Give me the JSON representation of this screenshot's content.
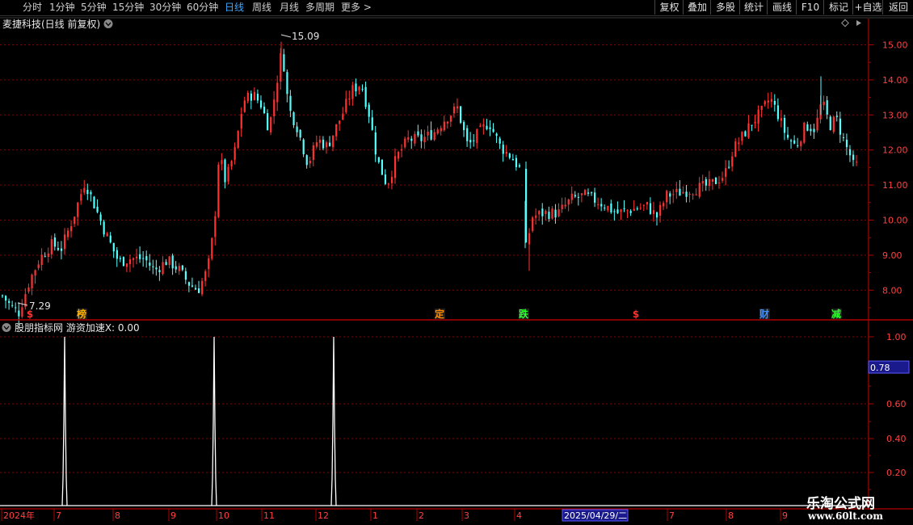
{
  "toolbar": {
    "periods": [
      {
        "label": "分时",
        "active": false
      },
      {
        "label": "1分钟",
        "active": false
      },
      {
        "label": "5分钟",
        "active": false
      },
      {
        "label": "15分钟",
        "active": false
      },
      {
        "label": "30分钟",
        "active": false
      },
      {
        "label": "60分钟",
        "active": false
      },
      {
        "label": "日线",
        "active": true
      },
      {
        "label": "周线",
        "active": false
      },
      {
        "label": "月线",
        "active": false
      },
      {
        "label": "多周期",
        "active": false
      },
      {
        "label": "更多 >",
        "active": false
      }
    ],
    "right_buttons": [
      "复权",
      "叠加",
      "多股",
      "统计",
      "画线",
      "F10",
      "标记",
      "+自选",
      "返回"
    ]
  },
  "main_panel": {
    "title": "麦捷科技(日线 前复权)",
    "title_icon": "chevron-down-icon",
    "settings_icon": "diamond-icon",
    "y_ticks": [
      "15.00",
      "14.00",
      "13.00",
      "12.00",
      "11.00",
      "10.00",
      "9.00",
      "8.00"
    ],
    "high_label": "15.09",
    "low_label": "7.29",
    "markers": [
      {
        "text": "$",
        "color": "#ff3030"
      },
      {
        "text": "榜",
        "color": "#ffb000"
      },
      {
        "text": "定",
        "color": "#ff8c00"
      },
      {
        "text": "跌",
        "color": "#30ff30"
      },
      {
        "text": "$",
        "color": "#ff3030"
      },
      {
        "text": "财",
        "color": "#4090ff"
      },
      {
        "text": "减",
        "color": "#30ff30"
      }
    ]
  },
  "indicator_panel": {
    "title": "股朋指标网  游资加速X: 0.00",
    "title_icon": "chevron-down-icon",
    "y_ticks": [
      "1.00",
      "0.60",
      "0.40",
      "0.20"
    ],
    "cursor_value": "0.78"
  },
  "date_axis": {
    "labels": [
      "2024年",
      "7",
      "8",
      "9",
      "10",
      "11",
      "12",
      "1",
      "2",
      "3",
      "4",
      "7",
      "8",
      "9"
    ],
    "cursor_date": "2025/04/29/二"
  },
  "watermark": {
    "line1": "乐淘公式网",
    "line2": "www.60lt.com"
  },
  "colors": {
    "up": "#ff3232",
    "down": "#54ffff",
    "grid": "#8b0000",
    "axis": "#b00000",
    "accent": "#3da8ff",
    "signal": "#ffffff"
  },
  "chart_data": {
    "type": "candlestick",
    "price_range": [
      7.2,
      15.35
    ],
    "close_path": [
      [
        0,
        7.9
      ],
      [
        12,
        7.55
      ],
      [
        22,
        7.35
      ],
      [
        36,
        8.3
      ],
      [
        48,
        8.9
      ],
      [
        62,
        9.3
      ],
      [
        75,
        9.2
      ],
      [
        90,
        10.1
      ],
      [
        104,
        11.1
      ],
      [
        118,
        10.3
      ],
      [
        130,
        9.6
      ],
      [
        146,
        8.8
      ],
      [
        160,
        8.9
      ],
      [
        178,
        8.9
      ],
      [
        190,
        8.55
      ],
      [
        206,
        8.85
      ],
      [
        220,
        8.6
      ],
      [
        232,
        8.2
      ],
      [
        244,
        8.0
      ],
      [
        256,
        8.6
      ],
      [
        264,
        9.8
      ],
      [
        270,
        11.9
      ],
      [
        278,
        11.1
      ],
      [
        290,
        12.0
      ],
      [
        300,
        13.4
      ],
      [
        312,
        13.6
      ],
      [
        322,
        13.3
      ],
      [
        332,
        12.6
      ],
      [
        342,
        14.0
      ],
      [
        348,
        14.9
      ],
      [
        356,
        13.2
      ],
      [
        366,
        12.7
      ],
      [
        380,
        11.6
      ],
      [
        392,
        12.3
      ],
      [
        404,
        12.1
      ],
      [
        414,
        12.6
      ],
      [
        424,
        13.1
      ],
      [
        434,
        13.7
      ],
      [
        446,
        13.9
      ],
      [
        456,
        13.0
      ],
      [
        466,
        11.7
      ],
      [
        478,
        11.0
      ],
      [
        490,
        11.8
      ],
      [
        504,
        12.3
      ],
      [
        520,
        12.3
      ],
      [
        536,
        12.5
      ],
      [
        550,
        12.9
      ],
      [
        565,
        13.2
      ],
      [
        578,
        12.1
      ],
      [
        592,
        12.5
      ],
      [
        604,
        12.8
      ],
      [
        618,
        12.1
      ],
      [
        632,
        11.8
      ],
      [
        644,
        11.4
      ],
      [
        650,
        9.2
      ],
      [
        658,
        10.1
      ],
      [
        672,
        10.2
      ],
      [
        690,
        10.2
      ],
      [
        706,
        10.6
      ],
      [
        722,
        10.7
      ],
      [
        742,
        10.5
      ],
      [
        762,
        10.2
      ],
      [
        780,
        10.3
      ],
      [
        800,
        10.4
      ],
      [
        812,
        10.1
      ],
      [
        824,
        10.7
      ],
      [
        842,
        10.8
      ],
      [
        860,
        10.9
      ],
      [
        878,
        11.0
      ],
      [
        896,
        11.3
      ],
      [
        906,
        12.0
      ],
      [
        918,
        12.4
      ],
      [
        930,
        12.8
      ],
      [
        942,
        13.1
      ],
      [
        952,
        13.5
      ],
      [
        962,
        13.0
      ],
      [
        972,
        12.4
      ],
      [
        984,
        12.1
      ],
      [
        996,
        12.7
      ],
      [
        1008,
        12.6
      ],
      [
        1016,
        13.4
      ],
      [
        1026,
        12.7
      ],
      [
        1034,
        12.9
      ],
      [
        1044,
        12.2
      ],
      [
        1052,
        11.8
      ],
      [
        1058,
        11.3
      ],
      [
        1062,
        12.3
      ]
    ],
    "indicator": {
      "name": "游资加速X",
      "value": 0.0,
      "spikes": [
        1.0,
        1.0,
        1.0
      ]
    }
  }
}
